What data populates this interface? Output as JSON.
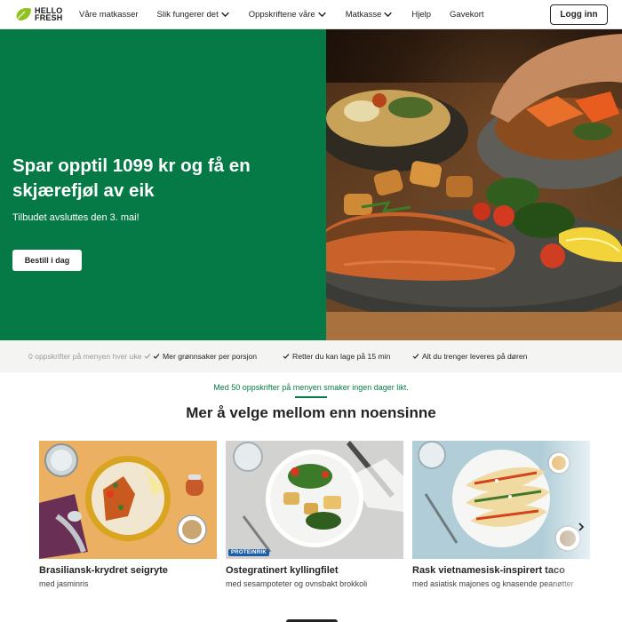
{
  "brand": {
    "line1": "HELLO",
    "line2": "FRESH",
    "accent": "#91c11e",
    "green": "#067a46"
  },
  "nav": {
    "links": [
      {
        "label": "Våre matkasser",
        "dropdown": false
      },
      {
        "label": "Slik fungerer det",
        "dropdown": true
      },
      {
        "label": "Oppskriftene våre",
        "dropdown": true
      },
      {
        "label": "Matkasse",
        "dropdown": true
      },
      {
        "label": "Hjelp",
        "dropdown": false
      },
      {
        "label": "Gavekort",
        "dropdown": false
      }
    ],
    "login_label": "Logg inn"
  },
  "hero": {
    "title": "Spar opptil 1099 kr og få en skjærefjøl av eik",
    "subtitle": "Tilbudet avsluttes den 3. mai!",
    "cta_label": "Bestill i dag"
  },
  "benefits": {
    "items": [
      {
        "label": "0 oppskrifter på menyen hver uke",
        "faded": true
      },
      {
        "label": "Mer grønnsaker per porsjon",
        "faded": false
      },
      {
        "label": "Retter du kan lage på 15 min",
        "faded": false
      },
      {
        "label": "Alt du trenger leveres på døren",
        "faded": false
      }
    ]
  },
  "recipes": {
    "kicker": "Med 50 oppskrifter på menyen smaker ingen dager likt.",
    "heading": "Mer å velge mellom enn noensinne",
    "cards": [
      {
        "title": "Brasiliansk-krydret seigryte",
        "desc": "med jasminris",
        "badge": ""
      },
      {
        "title": "Ostegratinert kyllingfilet",
        "desc": "med sesampoteter og ovnsbakt brokkoli",
        "badge": "PROTEINRIK"
      },
      {
        "title": "Rask vietnamesisk-inspirert taco",
        "desc": "med asiatisk majones og knasende peanøtter",
        "badge": ""
      }
    ]
  }
}
